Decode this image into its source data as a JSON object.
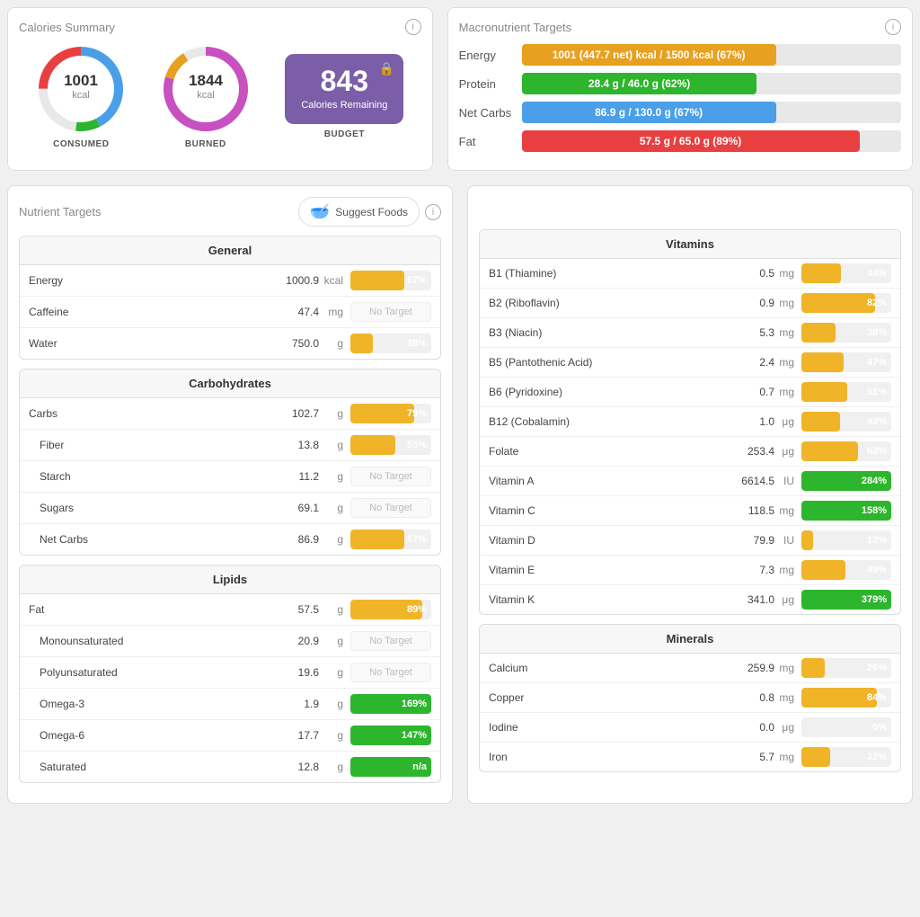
{
  "calories_summary": {
    "title": "Calories Summary",
    "consumed": {
      "value": "1001",
      "unit": "kcal",
      "label": "CONSUMED"
    },
    "burned": {
      "value": "1844",
      "unit": "kcal",
      "label": "BURNED"
    },
    "budget": {
      "value": "843",
      "label": "Calories Remaining",
      "sublabel": "BUDGET"
    }
  },
  "macronutrients": {
    "title": "Macronutrient Targets",
    "rows": [
      {
        "name": "Energy",
        "bar_text": "1001 (447.7 net) kcal / 1500 kcal (67%)",
        "pct": 67,
        "type": "energy"
      },
      {
        "name": "Protein",
        "bar_text": "28.4 g / 46.0 g (62%)",
        "pct": 62,
        "type": "protein"
      },
      {
        "name": "Net Carbs",
        "bar_text": "86.9 g / 130.0 g (67%)",
        "pct": 67,
        "type": "carbs"
      },
      {
        "name": "Fat",
        "bar_text": "57.5 g / 65.0 g (89%)",
        "pct": 89,
        "type": "fat"
      }
    ]
  },
  "nutrient_targets": {
    "title": "Nutrient Targets",
    "suggest_label": "Suggest Foods",
    "general": {
      "header": "General",
      "rows": [
        {
          "name": "Energy",
          "value": "1000.9",
          "unit": "kcal",
          "pct": 67,
          "pct_label": "67%",
          "no_target": false,
          "green": false,
          "na": false
        },
        {
          "name": "Caffeine",
          "value": "47.4",
          "unit": "mg",
          "pct": 0,
          "pct_label": "",
          "no_target": true,
          "green": false,
          "na": false
        },
        {
          "name": "Water",
          "value": "750.0",
          "unit": "g",
          "pct": 28,
          "pct_label": "28%",
          "no_target": false,
          "green": false,
          "na": false
        }
      ]
    },
    "carbohydrates": {
      "header": "Carbohydrates",
      "rows": [
        {
          "name": "Carbs",
          "value": "102.7",
          "unit": "g",
          "pct": 79,
          "pct_label": "79%",
          "no_target": false,
          "green": false,
          "na": false,
          "indent": false
        },
        {
          "name": "Fiber",
          "value": "13.8",
          "unit": "g",
          "pct": 55,
          "pct_label": "55%",
          "no_target": false,
          "green": false,
          "na": false,
          "indent": true
        },
        {
          "name": "Starch",
          "value": "11.2",
          "unit": "g",
          "pct": 0,
          "pct_label": "",
          "no_target": true,
          "green": false,
          "na": false,
          "indent": true
        },
        {
          "name": "Sugars",
          "value": "69.1",
          "unit": "g",
          "pct": 0,
          "pct_label": "",
          "no_target": true,
          "green": false,
          "na": false,
          "indent": true
        },
        {
          "name": "Net Carbs",
          "value": "86.9",
          "unit": "g",
          "pct": 67,
          "pct_label": "67%",
          "no_target": false,
          "green": false,
          "na": false,
          "indent": true
        }
      ]
    },
    "lipids": {
      "header": "Lipids",
      "rows": [
        {
          "name": "Fat",
          "value": "57.5",
          "unit": "g",
          "pct": 89,
          "pct_label": "89%",
          "no_target": false,
          "green": false,
          "na": false,
          "indent": false
        },
        {
          "name": "Monounsaturated",
          "value": "20.9",
          "unit": "g",
          "pct": 0,
          "pct_label": "",
          "no_target": true,
          "green": false,
          "na": false,
          "indent": true
        },
        {
          "name": "Polyunsaturated",
          "value": "19.6",
          "unit": "g",
          "pct": 0,
          "pct_label": "",
          "no_target": true,
          "green": false,
          "na": false,
          "indent": true
        },
        {
          "name": "Omega-3",
          "value": "1.9",
          "unit": "g",
          "pct": 100,
          "pct_label": "169%",
          "no_target": false,
          "green": true,
          "na": false,
          "indent": true
        },
        {
          "name": "Omega-6",
          "value": "17.7",
          "unit": "g",
          "pct": 100,
          "pct_label": "147%",
          "no_target": false,
          "green": true,
          "na": false,
          "indent": true
        },
        {
          "name": "Saturated",
          "value": "12.8",
          "unit": "g",
          "pct": 100,
          "pct_label": "n/a",
          "no_target": false,
          "green": true,
          "na": true,
          "indent": true
        }
      ]
    }
  },
  "vitamins": {
    "header": "Vitamins",
    "rows": [
      {
        "name": "B1 (Thiamine)",
        "value": "0.5",
        "unit": "mg",
        "pct": 44,
        "pct_label": "44%",
        "green": false
      },
      {
        "name": "B2 (Riboflavin)",
        "value": "0.9",
        "unit": "mg",
        "pct": 82,
        "pct_label": "82%",
        "green": false
      },
      {
        "name": "B3 (Niacin)",
        "value": "5.3",
        "unit": "mg",
        "pct": 38,
        "pct_label": "38%",
        "green": false
      },
      {
        "name": "B5 (Pantothenic Acid)",
        "value": "2.4",
        "unit": "mg",
        "pct": 47,
        "pct_label": "47%",
        "green": false
      },
      {
        "name": "B6 (Pyridoxine)",
        "value": "0.7",
        "unit": "mg",
        "pct": 51,
        "pct_label": "51%",
        "green": false
      },
      {
        "name": "B12 (Cobalamin)",
        "value": "1.0",
        "unit": "μg",
        "pct": 43,
        "pct_label": "43%",
        "green": false
      },
      {
        "name": "Folate",
        "value": "253.4",
        "unit": "μg",
        "pct": 63,
        "pct_label": "63%",
        "green": false
      },
      {
        "name": "Vitamin A",
        "value": "6614.5",
        "unit": "IU",
        "pct": 100,
        "pct_label": "284%",
        "green": true
      },
      {
        "name": "Vitamin C",
        "value": "118.5",
        "unit": "mg",
        "pct": 100,
        "pct_label": "158%",
        "green": true
      },
      {
        "name": "Vitamin D",
        "value": "79.9",
        "unit": "IU",
        "pct": 13,
        "pct_label": "13%",
        "green": false
      },
      {
        "name": "Vitamin E",
        "value": "7.3",
        "unit": "mg",
        "pct": 49,
        "pct_label": "49%",
        "green": false
      },
      {
        "name": "Vitamin K",
        "value": "341.0",
        "unit": "μg",
        "pct": 100,
        "pct_label": "379%",
        "green": true
      }
    ]
  },
  "minerals": {
    "header": "Minerals",
    "rows": [
      {
        "name": "Calcium",
        "value": "259.9",
        "unit": "mg",
        "pct": 26,
        "pct_label": "26%",
        "green": false
      },
      {
        "name": "Copper",
        "value": "0.8",
        "unit": "mg",
        "pct": 84,
        "pct_label": "84%",
        "green": false
      },
      {
        "name": "Iodine",
        "value": "0.0",
        "unit": "μg",
        "pct": 0,
        "pct_label": "0%",
        "green": false
      },
      {
        "name": "Iron",
        "value": "5.7",
        "unit": "mg",
        "pct": 32,
        "pct_label": "32%",
        "green": false
      }
    ]
  }
}
